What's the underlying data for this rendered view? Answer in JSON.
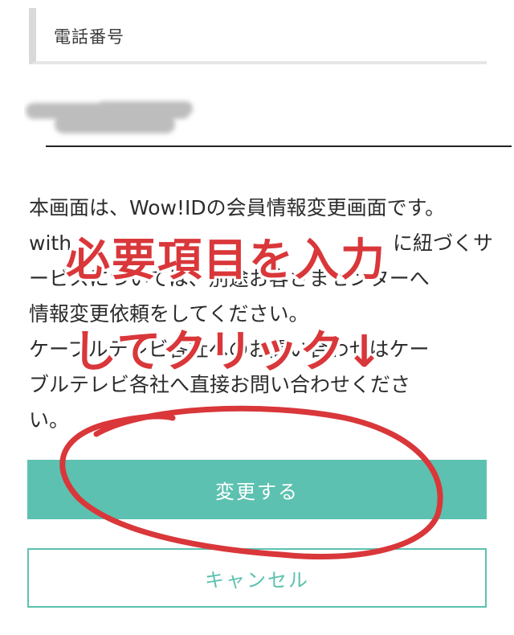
{
  "phone_section": {
    "label": "電話番号"
  },
  "notice": {
    "lines": [
      "本画面は、Wow!IDの会員情報変更画面です。",
      "with　　　　　　　　　　　　　　　　に紐づくサ",
      "ービスについては、別途お客さまセンターへ",
      "情報変更依頼をしてください。",
      "ケーブルテレビ各社へのお問い合わせはケー",
      "ブルテレビ各社へ直接お問い合わせくださ",
      "い。"
    ]
  },
  "buttons": {
    "change_label": "変更する",
    "cancel_label": "キャンセル"
  },
  "annotation": {
    "line1": "必要項目を入力",
    "line2": "してクリック↓",
    "color": "#d9373a",
    "outline_color": "#ffffff"
  },
  "colors": {
    "accent": "#5cc1b0",
    "redaction": "#bdbdbd"
  }
}
